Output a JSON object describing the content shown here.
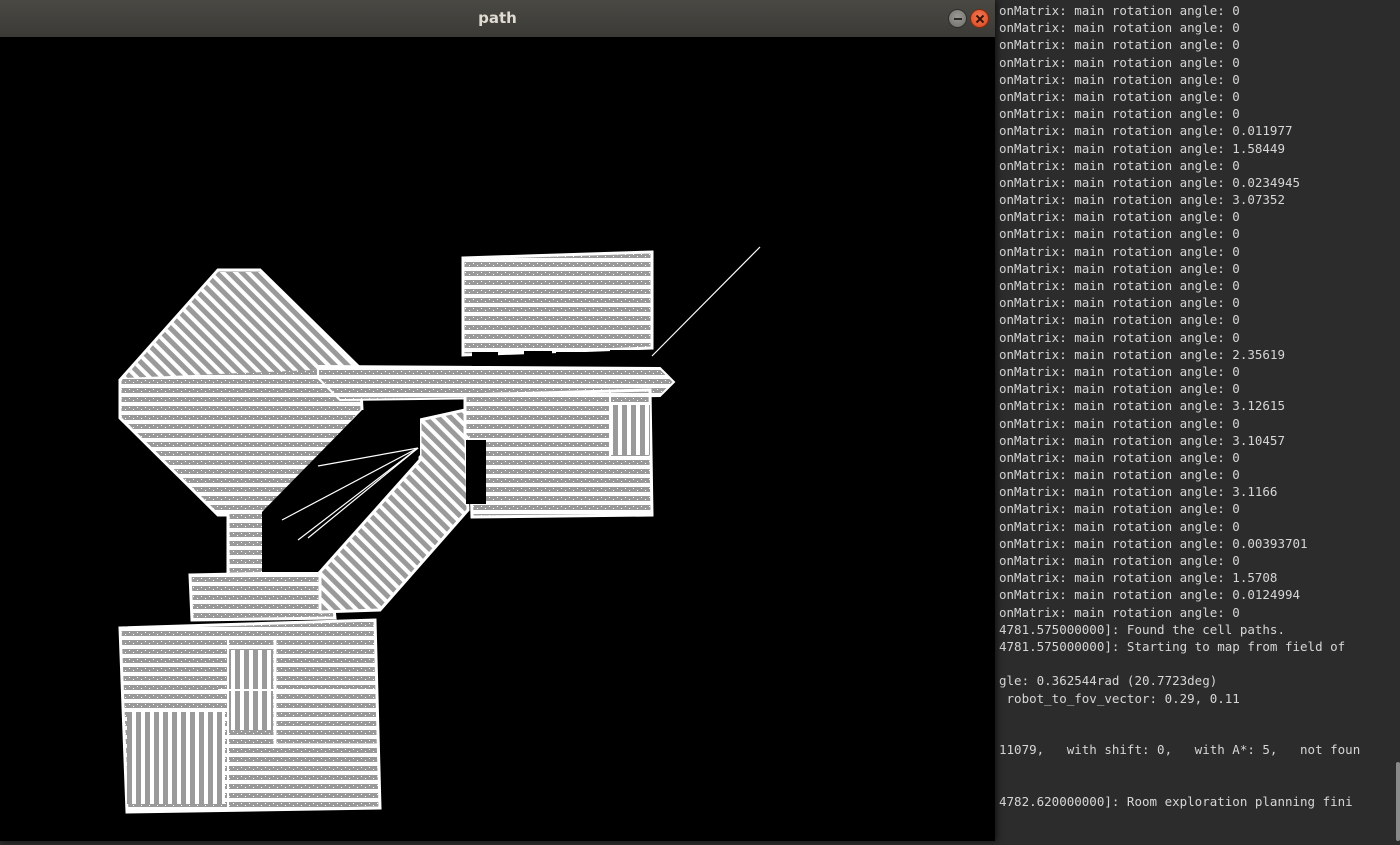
{
  "window": {
    "title": "path"
  },
  "terminal": {
    "lines": [
      "onMatrix: main rotation angle: 0",
      "onMatrix: main rotation angle: 0",
      "onMatrix: main rotation angle: 0",
      "onMatrix: main rotation angle: 0",
      "onMatrix: main rotation angle: 0",
      "onMatrix: main rotation angle: 0",
      "onMatrix: main rotation angle: 0",
      "onMatrix: main rotation angle: 0.011977",
      "onMatrix: main rotation angle: 1.58449",
      "onMatrix: main rotation angle: 0",
      "onMatrix: main rotation angle: 0.0234945",
      "onMatrix: main rotation angle: 3.07352",
      "onMatrix: main rotation angle: 0",
      "onMatrix: main rotation angle: 0",
      "onMatrix: main rotation angle: 0",
      "onMatrix: main rotation angle: 0",
      "onMatrix: main rotation angle: 0",
      "onMatrix: main rotation angle: 0",
      "onMatrix: main rotation angle: 0",
      "onMatrix: main rotation angle: 0",
      "onMatrix: main rotation angle: 2.35619",
      "onMatrix: main rotation angle: 0",
      "onMatrix: main rotation angle: 0",
      "onMatrix: main rotation angle: 3.12615",
      "onMatrix: main rotation angle: 0",
      "onMatrix: main rotation angle: 3.10457",
      "onMatrix: main rotation angle: 0",
      "onMatrix: main rotation angle: 0",
      "onMatrix: main rotation angle: 3.1166",
      "onMatrix: main rotation angle: 0",
      "onMatrix: main rotation angle: 0",
      "onMatrix: main rotation angle: 0.00393701",
      "onMatrix: main rotation angle: 0",
      "onMatrix: main rotation angle: 1.5708",
      "onMatrix: main rotation angle: 0.0124994",
      "onMatrix: main rotation angle: 0",
      "4781.575000000]: Found the cell paths.",
      "4781.575000000]: Starting to map from field of",
      "",
      "gle: 0.362544rad (20.7723deg)",
      " robot_to_fov_vector: 0.29, 0.11",
      "",
      "",
      "11079,   with shift: 0,   with A*: 5,   not foun",
      "",
      "",
      "4782.620000000]: Room exploration planning fini"
    ]
  },
  "colors": {
    "background": "#000000",
    "path": "#9a9a9a",
    "free": "#ffffff",
    "terminal_text": "#d6d6d6"
  }
}
